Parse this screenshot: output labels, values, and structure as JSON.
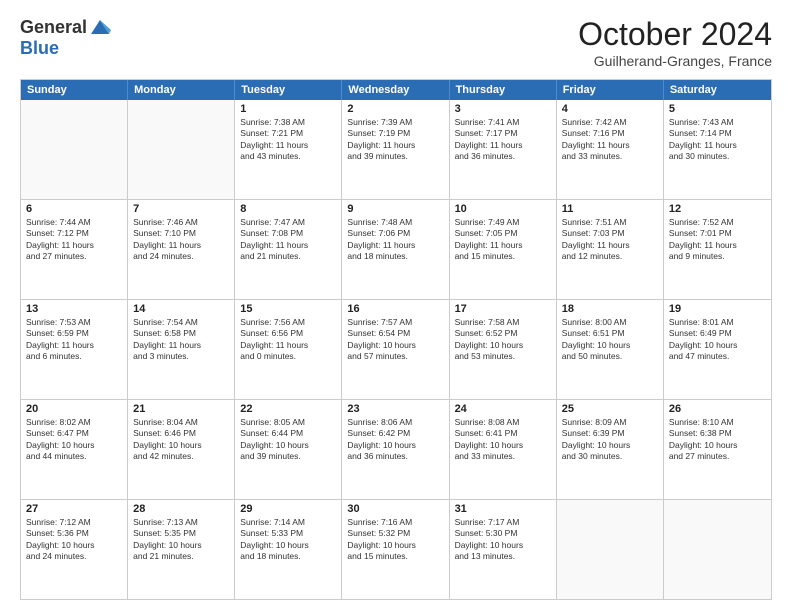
{
  "header": {
    "logo_general": "General",
    "logo_blue": "Blue",
    "month_title": "October 2024",
    "location": "Guilherand-Granges, France"
  },
  "days_of_week": [
    "Sunday",
    "Monday",
    "Tuesday",
    "Wednesday",
    "Thursday",
    "Friday",
    "Saturday"
  ],
  "rows": [
    [
      {
        "day": "",
        "lines": []
      },
      {
        "day": "",
        "lines": []
      },
      {
        "day": "1",
        "lines": [
          "Sunrise: 7:38 AM",
          "Sunset: 7:21 PM",
          "Daylight: 11 hours",
          "and 43 minutes."
        ]
      },
      {
        "day": "2",
        "lines": [
          "Sunrise: 7:39 AM",
          "Sunset: 7:19 PM",
          "Daylight: 11 hours",
          "and 39 minutes."
        ]
      },
      {
        "day": "3",
        "lines": [
          "Sunrise: 7:41 AM",
          "Sunset: 7:17 PM",
          "Daylight: 11 hours",
          "and 36 minutes."
        ]
      },
      {
        "day": "4",
        "lines": [
          "Sunrise: 7:42 AM",
          "Sunset: 7:16 PM",
          "Daylight: 11 hours",
          "and 33 minutes."
        ]
      },
      {
        "day": "5",
        "lines": [
          "Sunrise: 7:43 AM",
          "Sunset: 7:14 PM",
          "Daylight: 11 hours",
          "and 30 minutes."
        ]
      }
    ],
    [
      {
        "day": "6",
        "lines": [
          "Sunrise: 7:44 AM",
          "Sunset: 7:12 PM",
          "Daylight: 11 hours",
          "and 27 minutes."
        ]
      },
      {
        "day": "7",
        "lines": [
          "Sunrise: 7:46 AM",
          "Sunset: 7:10 PM",
          "Daylight: 11 hours",
          "and 24 minutes."
        ]
      },
      {
        "day": "8",
        "lines": [
          "Sunrise: 7:47 AM",
          "Sunset: 7:08 PM",
          "Daylight: 11 hours",
          "and 21 minutes."
        ]
      },
      {
        "day": "9",
        "lines": [
          "Sunrise: 7:48 AM",
          "Sunset: 7:06 PM",
          "Daylight: 11 hours",
          "and 18 minutes."
        ]
      },
      {
        "day": "10",
        "lines": [
          "Sunrise: 7:49 AM",
          "Sunset: 7:05 PM",
          "Daylight: 11 hours",
          "and 15 minutes."
        ]
      },
      {
        "day": "11",
        "lines": [
          "Sunrise: 7:51 AM",
          "Sunset: 7:03 PM",
          "Daylight: 11 hours",
          "and 12 minutes."
        ]
      },
      {
        "day": "12",
        "lines": [
          "Sunrise: 7:52 AM",
          "Sunset: 7:01 PM",
          "Daylight: 11 hours",
          "and 9 minutes."
        ]
      }
    ],
    [
      {
        "day": "13",
        "lines": [
          "Sunrise: 7:53 AM",
          "Sunset: 6:59 PM",
          "Daylight: 11 hours",
          "and 6 minutes."
        ]
      },
      {
        "day": "14",
        "lines": [
          "Sunrise: 7:54 AM",
          "Sunset: 6:58 PM",
          "Daylight: 11 hours",
          "and 3 minutes."
        ]
      },
      {
        "day": "15",
        "lines": [
          "Sunrise: 7:56 AM",
          "Sunset: 6:56 PM",
          "Daylight: 11 hours",
          "and 0 minutes."
        ]
      },
      {
        "day": "16",
        "lines": [
          "Sunrise: 7:57 AM",
          "Sunset: 6:54 PM",
          "Daylight: 10 hours",
          "and 57 minutes."
        ]
      },
      {
        "day": "17",
        "lines": [
          "Sunrise: 7:58 AM",
          "Sunset: 6:52 PM",
          "Daylight: 10 hours",
          "and 53 minutes."
        ]
      },
      {
        "day": "18",
        "lines": [
          "Sunrise: 8:00 AM",
          "Sunset: 6:51 PM",
          "Daylight: 10 hours",
          "and 50 minutes."
        ]
      },
      {
        "day": "19",
        "lines": [
          "Sunrise: 8:01 AM",
          "Sunset: 6:49 PM",
          "Daylight: 10 hours",
          "and 47 minutes."
        ]
      }
    ],
    [
      {
        "day": "20",
        "lines": [
          "Sunrise: 8:02 AM",
          "Sunset: 6:47 PM",
          "Daylight: 10 hours",
          "and 44 minutes."
        ]
      },
      {
        "day": "21",
        "lines": [
          "Sunrise: 8:04 AM",
          "Sunset: 6:46 PM",
          "Daylight: 10 hours",
          "and 42 minutes."
        ]
      },
      {
        "day": "22",
        "lines": [
          "Sunrise: 8:05 AM",
          "Sunset: 6:44 PM",
          "Daylight: 10 hours",
          "and 39 minutes."
        ]
      },
      {
        "day": "23",
        "lines": [
          "Sunrise: 8:06 AM",
          "Sunset: 6:42 PM",
          "Daylight: 10 hours",
          "and 36 minutes."
        ]
      },
      {
        "day": "24",
        "lines": [
          "Sunrise: 8:08 AM",
          "Sunset: 6:41 PM",
          "Daylight: 10 hours",
          "and 33 minutes."
        ]
      },
      {
        "day": "25",
        "lines": [
          "Sunrise: 8:09 AM",
          "Sunset: 6:39 PM",
          "Daylight: 10 hours",
          "and 30 minutes."
        ]
      },
      {
        "day": "26",
        "lines": [
          "Sunrise: 8:10 AM",
          "Sunset: 6:38 PM",
          "Daylight: 10 hours",
          "and 27 minutes."
        ]
      }
    ],
    [
      {
        "day": "27",
        "lines": [
          "Sunrise: 7:12 AM",
          "Sunset: 5:36 PM",
          "Daylight: 10 hours",
          "and 24 minutes."
        ]
      },
      {
        "day": "28",
        "lines": [
          "Sunrise: 7:13 AM",
          "Sunset: 5:35 PM",
          "Daylight: 10 hours",
          "and 21 minutes."
        ]
      },
      {
        "day": "29",
        "lines": [
          "Sunrise: 7:14 AM",
          "Sunset: 5:33 PM",
          "Daylight: 10 hours",
          "and 18 minutes."
        ]
      },
      {
        "day": "30",
        "lines": [
          "Sunrise: 7:16 AM",
          "Sunset: 5:32 PM",
          "Daylight: 10 hours",
          "and 15 minutes."
        ]
      },
      {
        "day": "31",
        "lines": [
          "Sunrise: 7:17 AM",
          "Sunset: 5:30 PM",
          "Daylight: 10 hours",
          "and 13 minutes."
        ]
      },
      {
        "day": "",
        "lines": []
      },
      {
        "day": "",
        "lines": []
      }
    ]
  ]
}
